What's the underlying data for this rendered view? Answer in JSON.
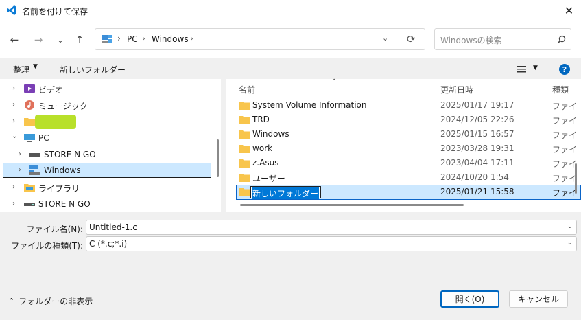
{
  "window": {
    "title": "名前を付けて保存",
    "close_label": "✕"
  },
  "nav": {
    "back": "←",
    "forward": "→",
    "recent": "⌄",
    "up": "↑",
    "breadcrumb": [
      "PC",
      "Windows"
    ],
    "separator": "›",
    "refresh": "⟳",
    "search_placeholder": "Windowsの検索"
  },
  "toolbar": {
    "organize": "整理",
    "new_folder": "新しいフォルダー",
    "help": "?"
  },
  "tree": [
    {
      "label": "ビデオ",
      "icon": "video-folder-icon"
    },
    {
      "label": "ミュージック",
      "icon": "music-folder-icon"
    },
    {
      "label": "",
      "icon": "folder-icon"
    },
    {
      "label": "PC",
      "icon": "pc-icon"
    },
    {
      "label": "STORE N GO",
      "icon": "drive-icon"
    },
    {
      "label": "Windows",
      "icon": "windows-drive-icon"
    },
    {
      "label": "ライブラリ",
      "icon": "library-icon"
    },
    {
      "label": "STORE N GO",
      "icon": "drive-icon"
    }
  ],
  "columns": {
    "name": "名前",
    "date": "更新日時",
    "type": "種類"
  },
  "files": [
    {
      "name": "System Volume Information",
      "date": "2025/01/17 19:17",
      "type": "ファイ"
    },
    {
      "name": "TRD",
      "date": "2024/12/05 22:26",
      "type": "ファイ"
    },
    {
      "name": "Windows",
      "date": "2025/01/15 16:57",
      "type": "ファイ"
    },
    {
      "name": "work",
      "date": "2023/03/28 19:31",
      "type": "ファイ"
    },
    {
      "name": "z.Asus",
      "date": "2023/04/04 17:11",
      "type": "ファイ"
    },
    {
      "name": "ユーザー",
      "date": "2024/10/20 1:54",
      "type": "ファイ"
    },
    {
      "name": "新しいフォルダー",
      "date": "2025/01/21 15:58",
      "type": "ファイ"
    }
  ],
  "form": {
    "filename_label": "ファイル名(N):",
    "filename_value": "Untitled-1.c",
    "filetype_label": "ファイルの種類(T):",
    "filetype_value": "C (*.c;*.i)"
  },
  "footer": {
    "hide_folders": "フォルダーの非表示",
    "open": "開く(O)",
    "cancel": "キャンセル"
  },
  "colors": {
    "accent": "#0067c0",
    "selection": "#cce8ff",
    "selection_border": "#0a64c8",
    "folder": "#f8c54c"
  }
}
